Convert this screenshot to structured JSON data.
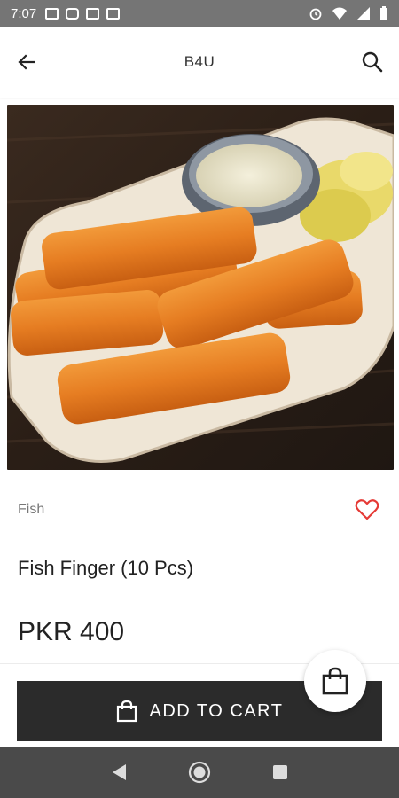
{
  "status_bar": {
    "time": "7:07"
  },
  "app_bar": {
    "title": "B4U",
    "back_icon": "arrow-left-icon",
    "search_icon": "search-icon"
  },
  "product": {
    "image_icon": "fish-fingers-photo",
    "category": "Fish",
    "name": "Fish Finger (10 Pcs)",
    "price": "PKR 400"
  },
  "actions": {
    "add_to_cart_label": "ADD TO CART"
  },
  "colors": {
    "heart": "#e53935",
    "button_bg": "#2b2b2b",
    "status_bar": "#757575",
    "nav_bar": "#4a4a4a"
  }
}
